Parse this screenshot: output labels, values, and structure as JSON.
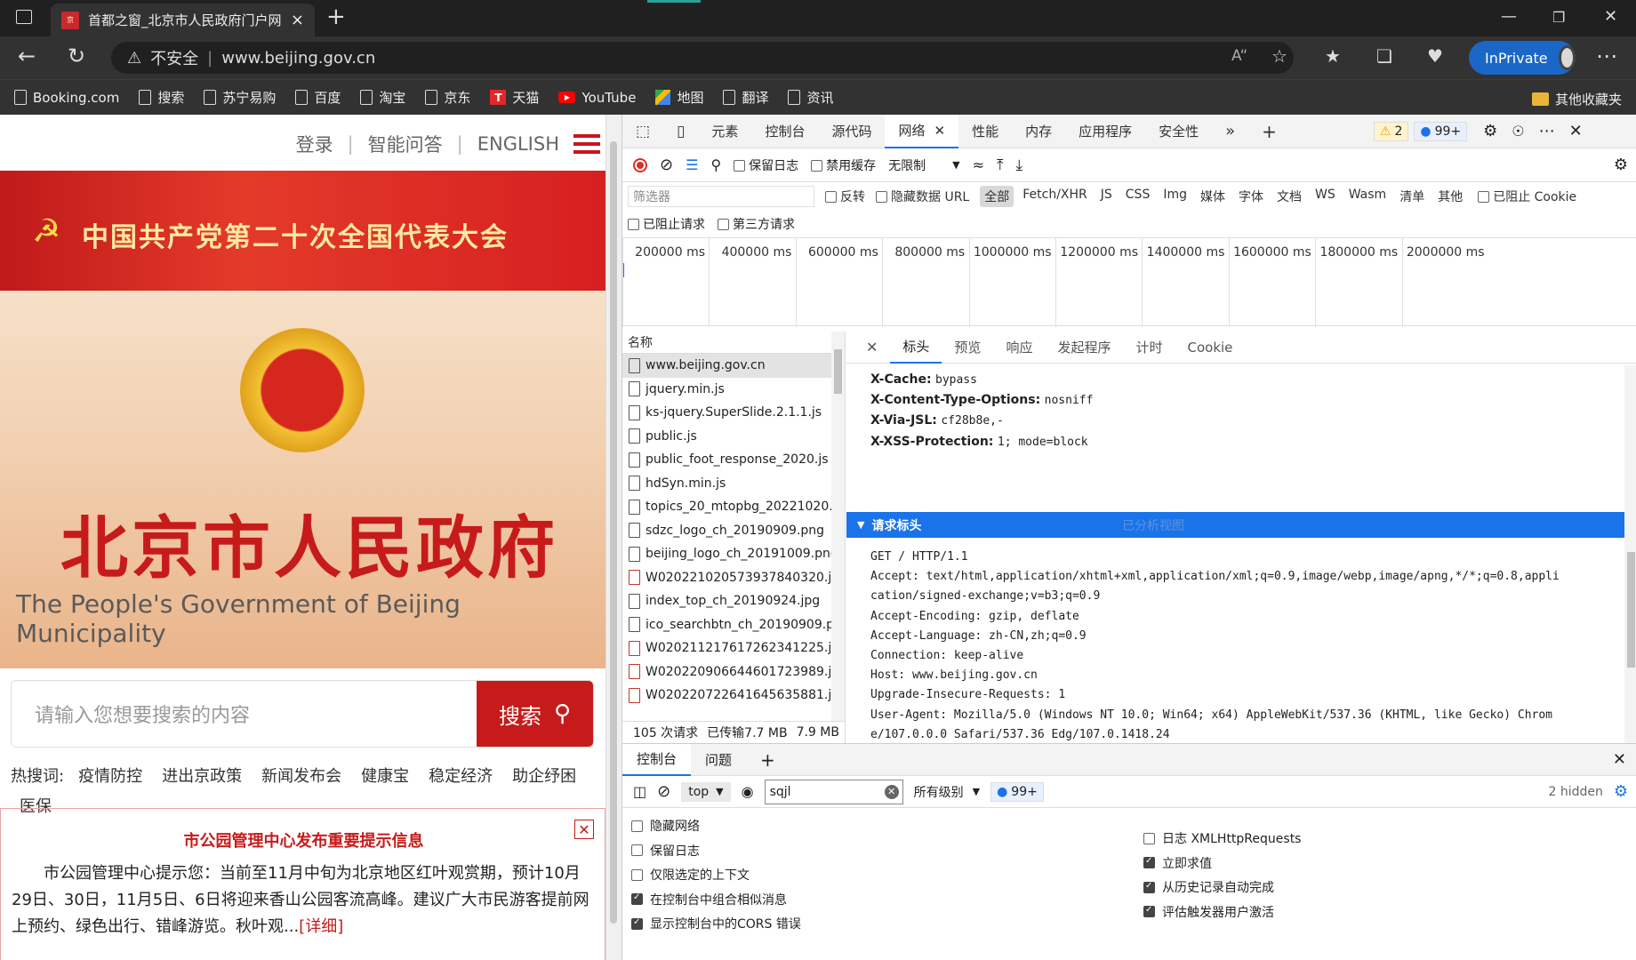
{
  "browser": {
    "tab_title": "首都之窗_北京市人民政府门户网",
    "tab_close": "×",
    "new_tab": "+",
    "security": "不安全",
    "url": "www.beijing.gov.cn",
    "inprivate": "InPrivate",
    "bookmarks": [
      "Booking.com",
      "搜索",
      "苏宁易购",
      "百度",
      "淘宝",
      "京东",
      "天猫",
      "YouTube",
      "地图",
      "翻译",
      "资讯"
    ],
    "other_bookmarks": "其他收藏夹"
  },
  "page": {
    "nav": [
      "登录",
      "智能问答",
      "ENGLISH"
    ],
    "banner_text": "中国共产党第二十次全国代表大会",
    "title_cn": "北京市人民政府",
    "title_en": "The People's Government of Beijing Municipality",
    "search_placeholder": "请输入您想要搜索的内容",
    "search_button": "搜索",
    "hot_label": "热搜词:",
    "hot_words": [
      "疫情防控",
      "进出京政策",
      "新闻发布会",
      "健康宝",
      "稳定经济",
      "助企纾困",
      "医保"
    ],
    "notice_title": "市公园管理中心发布重要提示信息",
    "notice_body": "市公园管理中心提示您：当前至11月中旬为北京地区红叶观赏期，预计10月29日、30日，11月5日、6日将迎来香山公园客流高峰。建议广大市民游客提前网上预约、绿色出行、错峰游览。秋叶观...",
    "notice_link": "[详细]"
  },
  "devtools": {
    "tabs": [
      "元素",
      "控制台",
      "源代码",
      "网络",
      "性能",
      "内存",
      "应用程序",
      "安全性"
    ],
    "active_tab": "网络",
    "warn_count": "2",
    "msg_count": "99+",
    "toolbar": {
      "preserve_log": "保留日志",
      "disable_cache": "禁用缓存",
      "throttle": "无限制"
    },
    "filter": {
      "placeholder": "筛选器",
      "invert": "反转",
      "hide_data_url": "隐藏数据 URL",
      "types": [
        "全部",
        "Fetch/XHR",
        "JS",
        "CSS",
        "Img",
        "媒体",
        "字体",
        "文档",
        "WS",
        "Wasm",
        "清单",
        "其他"
      ],
      "blocked_cookies": "已阻止 Cookie",
      "blocked_requests": "已阻止请求",
      "third_party": "第三方请求"
    },
    "timeline_ticks": [
      "200000 ms",
      "400000 ms",
      "600000 ms",
      "800000 ms",
      "1000000 ms",
      "1200000 ms",
      "1400000 ms",
      "1600000 ms",
      "1800000 ms",
      "2000000 ms"
    ],
    "name_header": "名称",
    "requests": [
      {
        "name": "www.beijing.gov.cn",
        "type": "doc"
      },
      {
        "name": "jquery.min.js",
        "type": "doc"
      },
      {
        "name": "ks-jquery.SuperSlide.2.1.1.js",
        "type": "doc"
      },
      {
        "name": "public.js",
        "type": "doc"
      },
      {
        "name": "public_foot_response_2020.js",
        "type": "doc"
      },
      {
        "name": "hdSyn.min.js",
        "type": "doc"
      },
      {
        "name": "topics_20_mtopbg_20221020.",
        "type": "doc"
      },
      {
        "name": "sdzc_logo_ch_20190909.png",
        "type": "doc"
      },
      {
        "name": "beijing_logo_ch_20191009.png",
        "type": "doc"
      },
      {
        "name": "W020221020573937840320.jp",
        "type": "img"
      },
      {
        "name": "index_top_ch_20190924.jpg",
        "type": "doc"
      },
      {
        "name": "ico_searchbtn_ch_20190909.p",
        "type": "doc"
      },
      {
        "name": "W020211217617262341225.jp",
        "type": "img"
      },
      {
        "name": "W020220906644601723989.jp",
        "type": "img"
      },
      {
        "name": "W020220722641645635881.jp",
        "type": "img"
      }
    ],
    "status": {
      "requests": "105 次请求",
      "transferred": "已传输7.7 MB",
      "resources": "7.9 MB"
    },
    "detail_tabs": [
      "标头",
      "预览",
      "响应",
      "发起程序",
      "计时",
      "Cookie"
    ],
    "response_headers": [
      {
        "k": "X-Cache:",
        "v": "bypass"
      },
      {
        "k": "X-Content-Type-Options:",
        "v": "nosniff"
      },
      {
        "k": "X-Via-JSL:",
        "v": "cf28b8e,-"
      },
      {
        "k": "X-XSS-Protection:",
        "v": "1; mode=block"
      }
    ],
    "request_headers_title": "请求标头",
    "parsed_view": "已分析视图",
    "request_lines": [
      "GET / HTTP/1.1",
      "Accept: text/html,application/xhtml+xml,application/xml;q=0.9,image/webp,image/apng,*/*;q=0.8,appli",
      "cation/signed-exchange;v=b3;q=0.9",
      "Accept-Encoding: gzip, deflate",
      "Accept-Language: zh-CN,zh;q=0.9",
      "Connection: keep-alive",
      "Host: www.beijing.gov.cn",
      "Upgrade-Insecure-Requests: 1",
      "User-Agent: Mozilla/5.0 (Windows NT 10.0; Win64; x64) AppleWebKit/537.36 (KHTML, like Gecko) Chrom",
      "e/107.0.0.0 Safari/537.36 Edg/107.0.1418.24"
    ],
    "drawer": {
      "tabs": [
        "控制台",
        "问题"
      ],
      "context": "top",
      "filter_value": "sqjl",
      "levels": "所有级别",
      "msg_count": "99+",
      "hidden": "2 hidden",
      "left_options": [
        {
          "label": "隐藏网络",
          "checked": false
        },
        {
          "label": "保留日志",
          "checked": false
        },
        {
          "label": "仅限选定的上下文",
          "checked": false
        },
        {
          "label": "在控制台中组合相似消息",
          "checked": true
        },
        {
          "label": "显示控制台中的CORS 错误",
          "checked": true
        }
      ],
      "right_options": [
        {
          "label": "日志 XMLHttpRequests",
          "checked": false
        },
        {
          "label": "立即求值",
          "checked": true
        },
        {
          "label": "从历史记录自动完成",
          "checked": true
        },
        {
          "label": "评估触发器用户激活",
          "checked": true
        }
      ]
    }
  }
}
